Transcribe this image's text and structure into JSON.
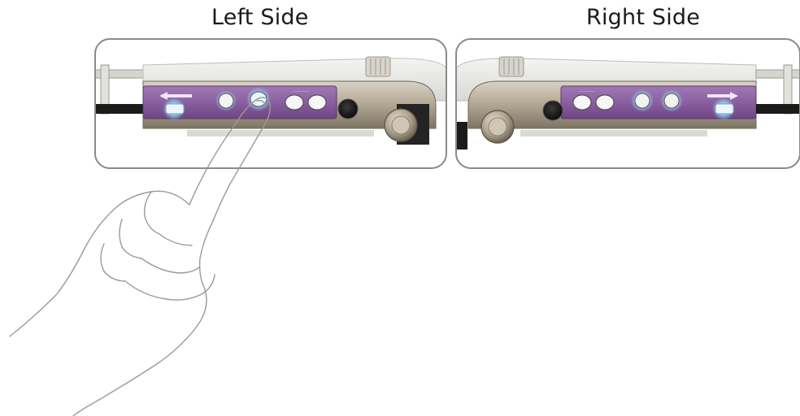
{
  "titles": {
    "left": "Left Side",
    "right": "Right Side"
  },
  "colors": {
    "panel_purple": "#8a5fa0",
    "button_glow": "#8fd4f7",
    "frame_border": "#8a8a8a",
    "metal": "#b5ab98"
  }
}
